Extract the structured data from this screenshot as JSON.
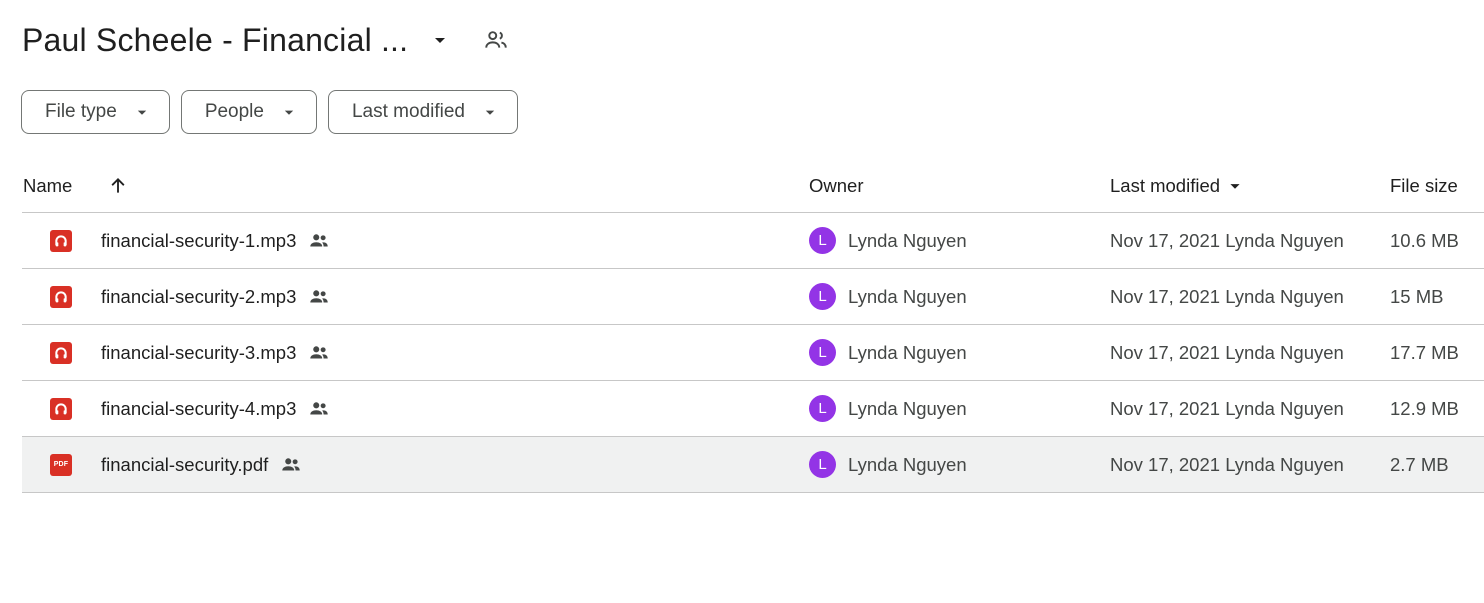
{
  "header": {
    "title": "Paul Scheele - Financial ...",
    "title_dropdown_icon": "arrow-drop-down-icon",
    "share_icon": "people-icon"
  },
  "filters": [
    {
      "label": "File type"
    },
    {
      "label": "People"
    },
    {
      "label": "Last modified"
    }
  ],
  "table": {
    "columns": {
      "name": "Name",
      "owner": "Owner",
      "last_modified": "Last modified",
      "file_size": "File size"
    },
    "sort": {
      "name_direction_icon": "arrow-upward-icon",
      "modified_direction_icon": "arrow-drop-down-icon"
    },
    "rows": [
      {
        "name": "financial-security-1.mp3",
        "type": "audio",
        "owner_initial": "L",
        "owner": "Lynda Nguyen",
        "modified": "Nov 17, 2021 Lynda Nguyen",
        "size": "10.6 MB",
        "selected": false
      },
      {
        "name": "financial-security-2.mp3",
        "type": "audio",
        "owner_initial": "L",
        "owner": "Lynda Nguyen",
        "modified": "Nov 17, 2021 Lynda Nguyen",
        "size": "15 MB",
        "selected": false
      },
      {
        "name": "financial-security-3.mp3",
        "type": "audio",
        "owner_initial": "L",
        "owner": "Lynda Nguyen",
        "modified": "Nov 17, 2021 Lynda Nguyen",
        "size": "17.7 MB",
        "selected": false
      },
      {
        "name": "financial-security-4.mp3",
        "type": "audio",
        "owner_initial": "L",
        "owner": "Lynda Nguyen",
        "modified": "Nov 17, 2021 Lynda Nguyen",
        "size": "12.9 MB",
        "selected": false
      },
      {
        "name": "financial-security.pdf",
        "type": "pdf",
        "type_badge": "PDF",
        "owner_initial": "L",
        "owner": "Lynda Nguyen",
        "modified": "Nov 17, 2021 Lynda Nguyen",
        "size": "2.7 MB",
        "selected": true
      }
    ]
  },
  "colors": {
    "file_icon_red": "#d93025",
    "avatar_purple": "#9334e6",
    "selected_row_bg": "#f0f1f1",
    "divider": "#c7c7c7"
  }
}
